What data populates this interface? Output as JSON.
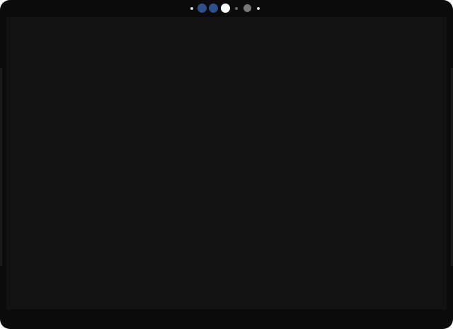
{
  "device": {
    "screen_state": "off",
    "colors": {
      "bezel": "#0b0b0b",
      "screen": "#121212"
    }
  },
  "sensors": [
    {
      "name": "ambient-light-sensor",
      "color": "#d9d9d9"
    },
    {
      "name": "ir-camera-left",
      "color": "#2f4f8a"
    },
    {
      "name": "ir-camera-right",
      "color": "#2f4f8a"
    },
    {
      "name": "front-camera",
      "color": "#ffffff"
    },
    {
      "name": "proximity-sensor",
      "color": "#6b6b6b"
    },
    {
      "name": "camera-sensor",
      "color": "#777777"
    },
    {
      "name": "status-led",
      "color": "#e0e0e0"
    }
  ]
}
